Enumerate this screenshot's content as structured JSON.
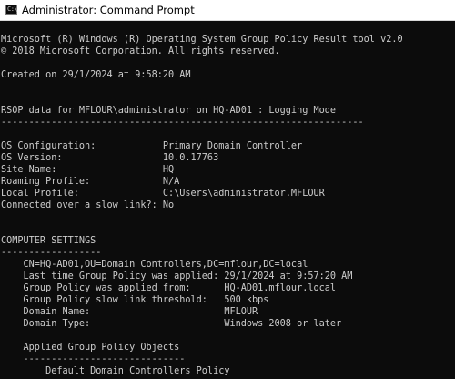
{
  "window": {
    "title": "Administrator: Command Prompt",
    "icon": "cmd-icon",
    "icon_text": "C:\\"
  },
  "colors": {
    "console_bg": "#0c0c0c",
    "console_fg": "#cccccc",
    "titlebar_bg": "#ffffff"
  },
  "console": {
    "lines": [
      "Microsoft (R) Windows (R) Operating System Group Policy Result tool v2.0",
      "© 2018 Microsoft Corporation. All rights reserved.",
      "",
      "Created on ‎29/‎1/‎2024 at 9:58:20 AM",
      "",
      "",
      "RSOP data for MFLOUR\\administrator on HQ-AD01 : Logging Mode",
      "-----------------------------------------------------------------",
      "",
      "OS Configuration:            Primary Domain Controller",
      "OS Version:                  10.0.17763",
      "Site Name:                   HQ",
      "Roaming Profile:             N/A",
      "Local Profile:               C:\\Users\\administrator.MFLOUR",
      "Connected over a slow link?: No",
      "",
      "",
      "COMPUTER SETTINGS",
      "------------------",
      "    CN=HQ-AD01,OU=Domain Controllers,DC=mflour,DC=local",
      "    Last time Group Policy was applied: 29/1/2024 at 9:57:20 AM",
      "    Group Policy was applied from:      HQ-AD01.mflour.local",
      "    Group Policy slow link threshold:   500 kbps",
      "    Domain Name:                        MFLOUR",
      "    Domain Type:                        Windows 2008 or later",
      "",
      "    Applied Group Policy Objects",
      "    -----------------------------",
      "        Default Domain Controllers Policy"
    ]
  }
}
